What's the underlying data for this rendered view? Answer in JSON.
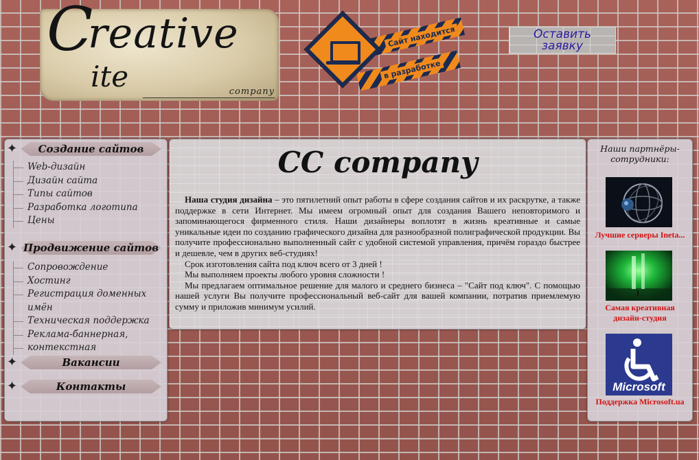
{
  "logo": {
    "letter_c": "C",
    "word_reative": "reative",
    "word_ite": "ite",
    "company": "company"
  },
  "construction": {
    "line1": "Сайт находится",
    "line2": "в разработке"
  },
  "request_button": {
    "line1": "Оставить",
    "line2": "заявку"
  },
  "sidebar": {
    "sections": [
      {
        "title": "Создание сайтов",
        "items": [
          "Web-дизайн",
          "Дизайн сайта",
          "Типы сайтов",
          "Разработка логотипа",
          "Цены"
        ]
      },
      {
        "title": "Продвижение сайтов",
        "items": [
          "Сопровождение",
          "Хостинг",
          "Регистрация доменных имён",
          "Техническая поддержка",
          "Реклама-баннерная,",
          "контекстная"
        ]
      },
      {
        "title": "Вакансии",
        "items": []
      },
      {
        "title": "Контакты",
        "items": []
      }
    ]
  },
  "main": {
    "title": "CC company",
    "intro_bold": "Наша студия дизайна",
    "intro_rest": " – это пятилетний опыт работы в сфере создания сайтов и их раскрутке, а также поддержке в сети Интернет. Мы имеем огромный опыт для создания Вашего неповторимого и запоминающегося фирменного стиля. Наши дизайнеры воплотят в жизнь креативные и самые уникальные идеи по созданию графического дизайна для разнообразной полиграфической продукции. Вы получите профессионально выполненный сайт с удобной системой управления, причём гораздо быстрее и дешевле, чем в других веб-студиях!",
    "p2": "Срок изготовления сайта под ключ всего от 3 дней !",
    "p3": "Мы выполняем проекты любого уровня сложности !",
    "p4": "Мы предлагаем оптимальное решение для малого и среднего бизнеса – \"Сайт под ключ\". С помощью нашей услуги Вы получите профессиональный веб-сайт для вашей компании, потратив приемлемую сумму и приложив минимум усилий."
  },
  "partners": {
    "title_line1": "Наши партнёры-",
    "title_line2": "сотрудники:",
    "items": [
      {
        "caption_line1": "Лучшие серверы Ineta...",
        "caption_line2": ""
      },
      {
        "caption_line1": "Самая креативная",
        "caption_line2": "дизайн-студия"
      },
      {
        "caption_line1": "Поддержка Microsoft.ua",
        "caption_line2": "",
        "logo_text": "Microsoft"
      }
    ]
  },
  "colors": {
    "brick": "#9a5a52",
    "panel": "#d6d0d6",
    "link_red": "#d21212",
    "button_text": "#2a1aa0",
    "construction_orange": "#f08a1c",
    "construction_navy": "#1b2a52"
  }
}
